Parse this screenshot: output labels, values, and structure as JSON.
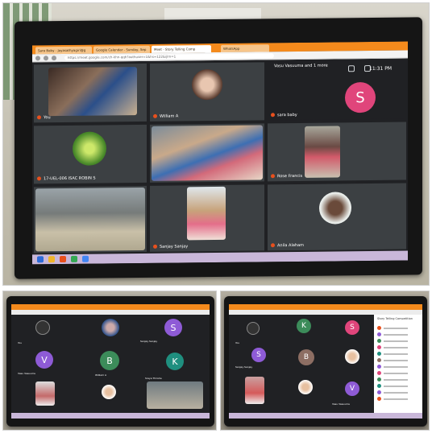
{
  "top_screen": {
    "tabs": [
      "Sara Baby - Jayasathyagiri@g",
      "Google Calendar - Sunday, Sep",
      "Meet - Story Telling Comp",
      "WhatsApp"
    ],
    "url": "https://meet.google.com/ch-khn-qqh?authuser=1&hs=122&ijlm=1",
    "presenting": "Vasu Vasuuma\nand 1 more",
    "clock": "11:31 PM",
    "tiles": {
      "row1_left": "You",
      "row1_mid": "William A",
      "row1_right": "sara baby",
      "row2_left": "17-UEL-006 ISAC ROBIN S",
      "row2_right": "Rose Francis",
      "row3_mid": "Sanjay Sanjay",
      "row3_right": "Anila Alaham"
    },
    "avatar_letter": "S"
  },
  "bottom_left": {
    "letters": [
      "S",
      "V",
      "B",
      "K"
    ],
    "names": [
      "You",
      "Vasu Vasuuma",
      "Sanjay Sanjay",
      "William A",
      "Sreya Thrisha"
    ]
  },
  "bottom_right": {
    "letters": [
      "K",
      "S",
      "S",
      "B",
      "V"
    ],
    "panel_title": "Story Telling Competition",
    "names": [
      "You",
      "Sanjay Sanjay",
      "Vasu Vasuuma"
    ]
  },
  "colors": {
    "meet_bg": "#202124",
    "tile_bg": "#3c4043",
    "tab_orange": "#f48a1c",
    "avatar_pink": "#e0457b",
    "avatar_purple": "#8e5bd6",
    "avatar_green": "#3c8c5a",
    "avatar_teal": "#1f8f7f",
    "avatar_brown": "#8d6e63"
  }
}
